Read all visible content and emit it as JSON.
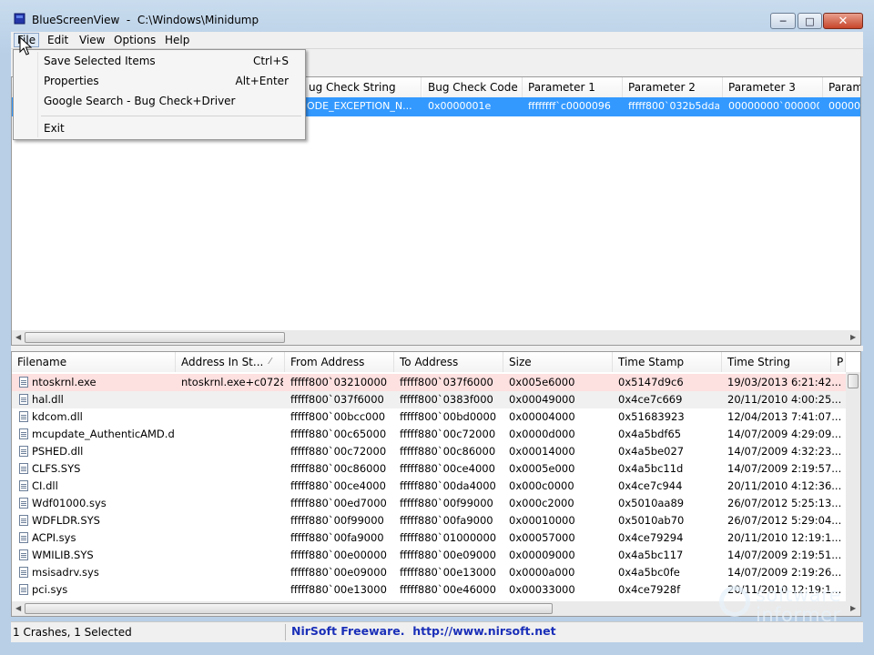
{
  "window": {
    "title": "BlueScreenView  -  C:\\Windows\\Minidump"
  },
  "menubar": [
    "File",
    "Edit",
    "View",
    "Options",
    "Help"
  ],
  "file_menu": {
    "items": [
      {
        "label": "Save Selected Items",
        "shortcut": "Ctrl+S"
      },
      {
        "label": "Properties",
        "shortcut": "Alt+Enter"
      },
      {
        "label": "Google Search - Bug Check+Driver",
        "shortcut": ""
      },
      {
        "label": "Exit",
        "shortcut": ""
      }
    ]
  },
  "crash_list": {
    "columns": [
      "ug Check String",
      "Bug Check Code",
      "Parameter 1",
      "Parameter 2",
      "Parameter 3",
      "Param"
    ],
    "rows": [
      [
        "ODE_EXCEPTION_N...",
        "0x0000001e",
        "ffffffff`c0000096",
        "fffff800`032b5dda",
        "00000000`000000...",
        "000000"
      ]
    ]
  },
  "driver_list": {
    "columns": [
      "Filename",
      "Address In St...",
      "From Address",
      "To Address",
      "Size",
      "Time Stamp",
      "Time String",
      "P"
    ],
    "rows": [
      [
        "ntoskrnl.exe",
        "ntoskrnl.exe+c0728",
        "fffff800`03210000",
        "fffff800`037f6000",
        "0x005e6000",
        "0x5147d9c6",
        "19/03/2013 6:21:42..."
      ],
      [
        "hal.dll",
        "",
        "fffff800`037f6000",
        "fffff800`0383f000",
        "0x00049000",
        "0x4ce7c669",
        "20/11/2010 4:00:25..."
      ],
      [
        "kdcom.dll",
        "",
        "fffff800`00bcc000",
        "fffff800`00bd0000",
        "0x00004000",
        "0x51683923",
        "12/04/2013 7:41:07..."
      ],
      [
        "mcupdate_AuthenticAMD.dll",
        "",
        "fffff880`00c65000",
        "fffff880`00c72000",
        "0x0000d000",
        "0x4a5bdf65",
        "14/07/2009 4:29:09..."
      ],
      [
        "PSHED.dll",
        "",
        "fffff880`00c72000",
        "fffff880`00c86000",
        "0x00014000",
        "0x4a5be027",
        "14/07/2009 4:32:23..."
      ],
      [
        "CLFS.SYS",
        "",
        "fffff880`00c86000",
        "fffff880`00ce4000",
        "0x0005e000",
        "0x4a5bc11d",
        "14/07/2009 2:19:57..."
      ],
      [
        "CI.dll",
        "",
        "fffff880`00ce4000",
        "fffff880`00da4000",
        "0x000c0000",
        "0x4ce7c944",
        "20/11/2010 4:12:36..."
      ],
      [
        "Wdf01000.sys",
        "",
        "fffff880`00ed7000",
        "fffff880`00f99000",
        "0x000c2000",
        "0x5010aa89",
        "26/07/2012 5:25:13..."
      ],
      [
        "WDFLDR.SYS",
        "",
        "fffff880`00f99000",
        "fffff880`00fa9000",
        "0x00010000",
        "0x5010ab70",
        "26/07/2012 5:29:04..."
      ],
      [
        "ACPI.sys",
        "",
        "fffff880`00fa9000",
        "fffff880`01000000",
        "0x00057000",
        "0x4ce79294",
        "20/11/2010 12:19:1..."
      ],
      [
        "WMILIB.SYS",
        "",
        "fffff880`00e00000",
        "fffff880`00e09000",
        "0x00009000",
        "0x4a5bc117",
        "14/07/2009 2:19:51..."
      ],
      [
        "msisadrv.sys",
        "",
        "fffff880`00e09000",
        "fffff880`00e13000",
        "0x0000a000",
        "0x4a5bc0fe",
        "14/07/2009 2:19:26..."
      ],
      [
        "pci.sys",
        "",
        "fffff880`00e13000",
        "fffff880`00e46000",
        "0x00033000",
        "0x4ce7928f",
        "20/11/2010 12:19:1..."
      ]
    ]
  },
  "statusbar": {
    "count": "1 Crashes, 1 Selected",
    "link": "NirSoft Freeware.  http://www.nirsoft.net"
  },
  "watermark": {
    "line1": "software",
    "line2": "informer"
  },
  "colors": {
    "selection": "#3399ff",
    "highlight_row": "#fde0e0",
    "link": "#1a2fb8"
  }
}
